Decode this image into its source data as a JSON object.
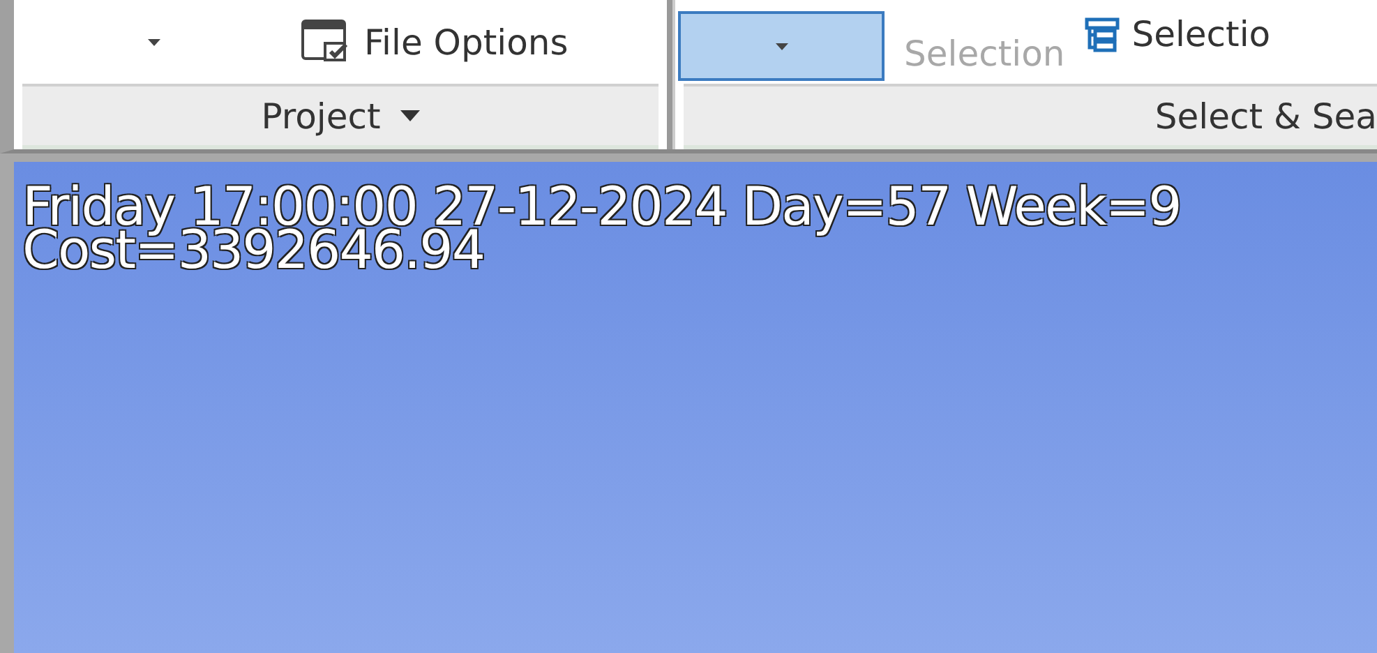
{
  "ribbon": {
    "groups": [
      {
        "label": "Project",
        "has_menu": true,
        "controls": [
          {
            "kind": "dropdown",
            "selected": false
          },
          {
            "kind": "button",
            "label": "File Options",
            "disabled": false
          }
        ]
      },
      {
        "label": "Select & Sea",
        "has_menu": false,
        "controls": [
          {
            "kind": "dropdown",
            "selected": true
          },
          {
            "kind": "button",
            "label": "Selection",
            "disabled": true
          },
          {
            "kind": "button",
            "label": "Selectio",
            "disabled": false
          }
        ]
      }
    ]
  },
  "viewport": {
    "lines": [
      "Friday 17:00:00 27-12-2024 Day=57 Week=9",
      "Cost=3392646.94"
    ]
  }
}
